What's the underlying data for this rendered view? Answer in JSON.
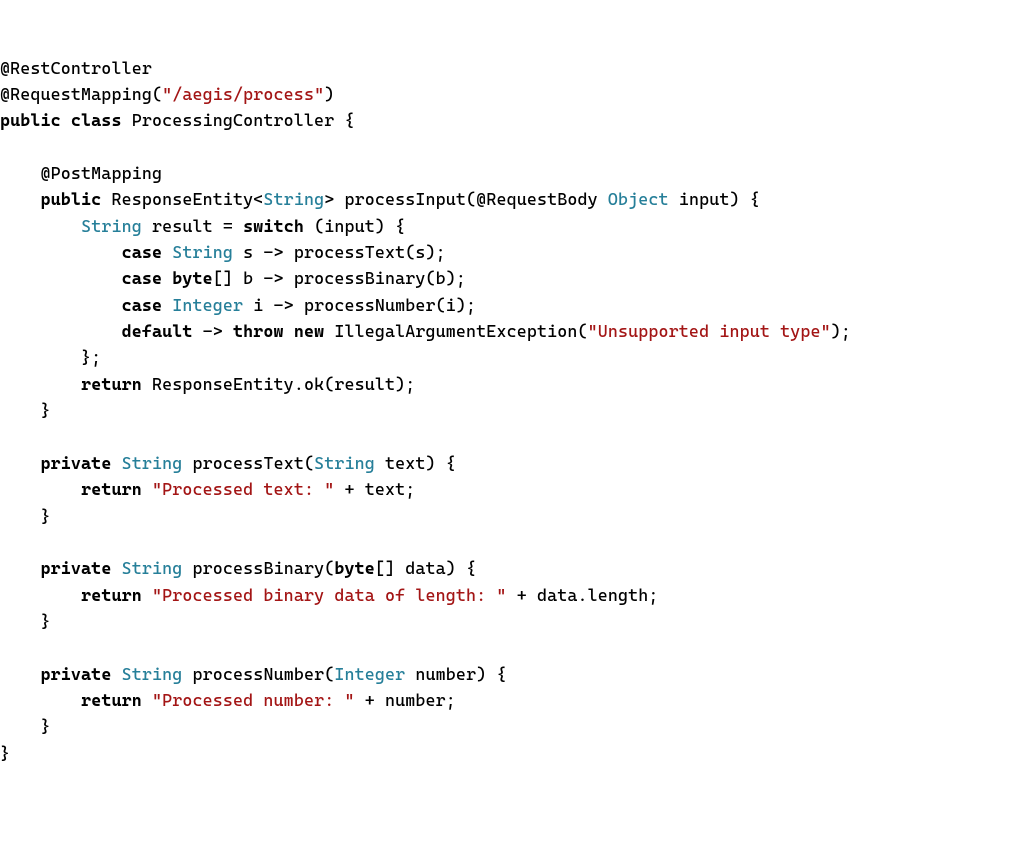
{
  "code": {
    "tokens": [
      [
        {
          "t": "@RestController"
        }
      ],
      [
        {
          "t": "@RequestMapping("
        },
        {
          "t": "\"/aegis/process\"",
          "c": "str"
        },
        {
          "t": ")"
        }
      ],
      [
        {
          "t": "public class ",
          "c": "kw"
        },
        {
          "t": "ProcessingController {"
        }
      ],
      [
        {
          "t": ""
        }
      ],
      [
        {
          "t": "    @PostMapping"
        }
      ],
      [
        {
          "t": "    "
        },
        {
          "t": "public ",
          "c": "kw"
        },
        {
          "t": "ResponseEntity<"
        },
        {
          "t": "String",
          "c": "type"
        },
        {
          "t": "> processInput(@RequestBody "
        },
        {
          "t": "Object",
          "c": "type"
        },
        {
          "t": " input) {"
        }
      ],
      [
        {
          "t": "        "
        },
        {
          "t": "String",
          "c": "type"
        },
        {
          "t": " result = "
        },
        {
          "t": "switch",
          "c": "kw"
        },
        {
          "t": " (input) {"
        }
      ],
      [
        {
          "t": "            "
        },
        {
          "t": "case ",
          "c": "kw"
        },
        {
          "t": "String",
          "c": "type"
        },
        {
          "t": " s -> processText(s);"
        }
      ],
      [
        {
          "t": "            "
        },
        {
          "t": "case ",
          "c": "kw"
        },
        {
          "t": "byte",
          "c": "kw"
        },
        {
          "t": "[] b -> processBinary(b);"
        }
      ],
      [
        {
          "t": "            "
        },
        {
          "t": "case ",
          "c": "kw"
        },
        {
          "t": "Integer",
          "c": "type"
        },
        {
          "t": " i -> processNumber(i);"
        }
      ],
      [
        {
          "t": "            "
        },
        {
          "t": "default",
          "c": "kw"
        },
        {
          "t": " -> "
        },
        {
          "t": "throw new ",
          "c": "kw"
        },
        {
          "t": "IllegalArgumentException("
        },
        {
          "t": "\"Unsupported input type\"",
          "c": "str"
        },
        {
          "t": ");"
        }
      ],
      [
        {
          "t": "        };"
        }
      ],
      [
        {
          "t": "        "
        },
        {
          "t": "return ",
          "c": "kw"
        },
        {
          "t": "ResponseEntity.ok(result);"
        }
      ],
      [
        {
          "t": "    }"
        }
      ],
      [
        {
          "t": ""
        }
      ],
      [
        {
          "t": "    "
        },
        {
          "t": "private ",
          "c": "kw"
        },
        {
          "t": "String",
          "c": "type"
        },
        {
          "t": " processText("
        },
        {
          "t": "String",
          "c": "type"
        },
        {
          "t": " text) {"
        }
      ],
      [
        {
          "t": "        "
        },
        {
          "t": "return ",
          "c": "kw"
        },
        {
          "t": "\"Processed text: \"",
          "c": "str"
        },
        {
          "t": " + text;"
        }
      ],
      [
        {
          "t": "    }"
        }
      ],
      [
        {
          "t": ""
        }
      ],
      [
        {
          "t": "    "
        },
        {
          "t": "private ",
          "c": "kw"
        },
        {
          "t": "String",
          "c": "type"
        },
        {
          "t": " processBinary("
        },
        {
          "t": "byte",
          "c": "kw"
        },
        {
          "t": "[] data) {"
        }
      ],
      [
        {
          "t": "        "
        },
        {
          "t": "return ",
          "c": "kw"
        },
        {
          "t": "\"Processed binary data of length: \"",
          "c": "str"
        },
        {
          "t": " + data.length;"
        }
      ],
      [
        {
          "t": "    }"
        }
      ],
      [
        {
          "t": ""
        }
      ],
      [
        {
          "t": "    "
        },
        {
          "t": "private ",
          "c": "kw"
        },
        {
          "t": "String",
          "c": "type"
        },
        {
          "t": " processNumber("
        },
        {
          "t": "Integer",
          "c": "type"
        },
        {
          "t": " number) {"
        }
      ],
      [
        {
          "t": "        "
        },
        {
          "t": "return ",
          "c": "kw"
        },
        {
          "t": "\"Processed number: \"",
          "c": "str"
        },
        {
          "t": " + number;"
        }
      ],
      [
        {
          "t": "    }"
        }
      ],
      [
        {
          "t": "}"
        }
      ]
    ]
  }
}
